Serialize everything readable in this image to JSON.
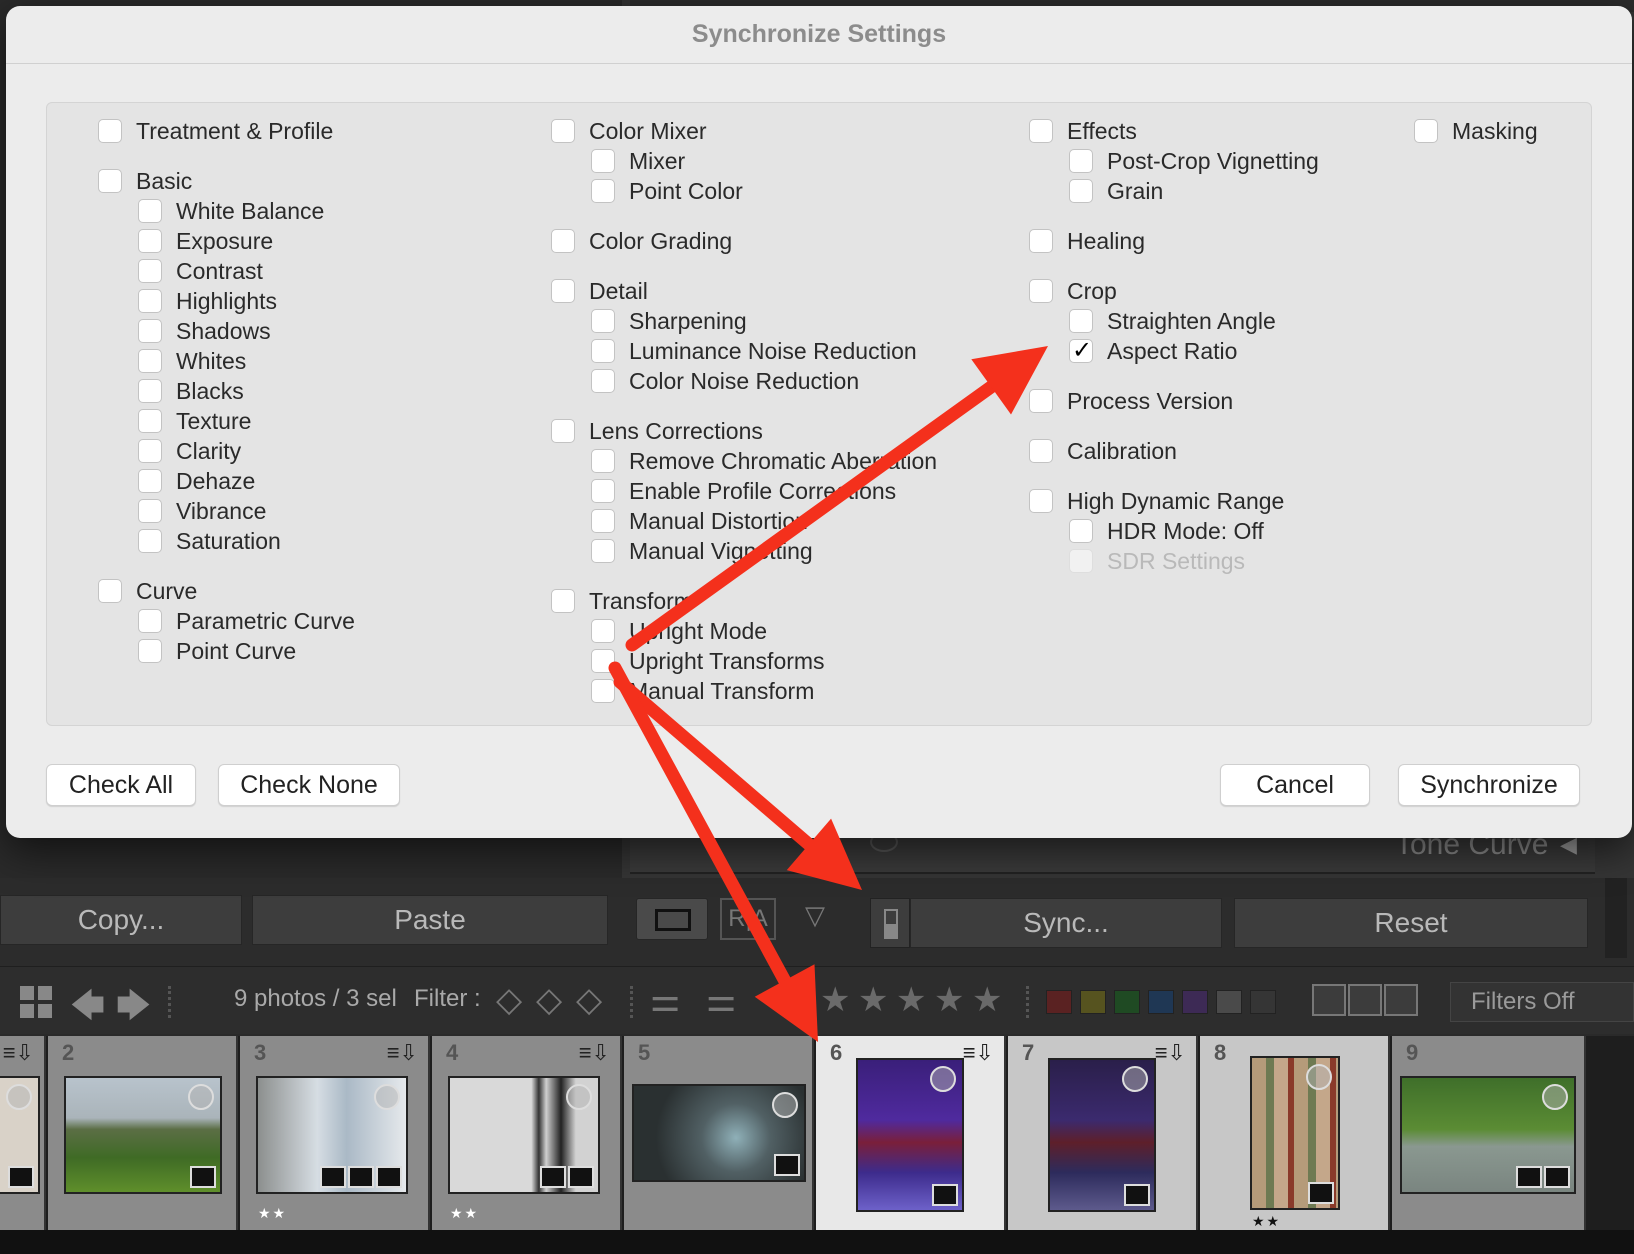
{
  "dialog": {
    "title": "Synchronize Settings",
    "buttons": {
      "check_all": "Check All",
      "check_none": "Check None",
      "cancel": "Cancel",
      "synchronize": "Synchronize"
    }
  },
  "settings": {
    "treatment_profile": {
      "label": "Treatment & Profile",
      "checked": false
    },
    "basic": {
      "label": "Basic",
      "checked": false,
      "children": [
        {
          "label": "White Balance",
          "checked": false
        },
        {
          "label": "Exposure",
          "checked": false
        },
        {
          "label": "Contrast",
          "checked": false
        },
        {
          "label": "Highlights",
          "checked": false
        },
        {
          "label": "Shadows",
          "checked": false
        },
        {
          "label": "Whites",
          "checked": false
        },
        {
          "label": "Blacks",
          "checked": false
        },
        {
          "label": "Texture",
          "checked": false
        },
        {
          "label": "Clarity",
          "checked": false
        },
        {
          "label": "Dehaze",
          "checked": false
        },
        {
          "label": "Vibrance",
          "checked": false
        },
        {
          "label": "Saturation",
          "checked": false
        }
      ]
    },
    "curve": {
      "label": "Curve",
      "checked": false,
      "children": [
        {
          "label": "Parametric Curve",
          "checked": false
        },
        {
          "label": "Point Curve",
          "checked": false
        }
      ]
    },
    "color_mixer": {
      "label": "Color Mixer",
      "checked": false,
      "children": [
        {
          "label": "Mixer",
          "checked": false
        },
        {
          "label": "Point Color",
          "checked": false
        }
      ]
    },
    "color_grading": {
      "label": "Color Grading",
      "checked": false
    },
    "detail": {
      "label": "Detail",
      "checked": false,
      "children": [
        {
          "label": "Sharpening",
          "checked": false
        },
        {
          "label": "Luminance Noise Reduction",
          "checked": false
        },
        {
          "label": "Color Noise Reduction",
          "checked": false
        }
      ]
    },
    "lens_corrections": {
      "label": "Lens Corrections",
      "checked": false,
      "children": [
        {
          "label": "Remove Chromatic Aberration",
          "checked": false
        },
        {
          "label": "Enable Profile Corrections",
          "checked": false
        },
        {
          "label": "Manual Distortion",
          "checked": false
        },
        {
          "label": "Manual Vignetting",
          "checked": false
        }
      ]
    },
    "transform": {
      "label": "Transform",
      "checked": false,
      "children": [
        {
          "label": "Upright Mode",
          "checked": false
        },
        {
          "label": "Upright Transforms",
          "checked": false
        },
        {
          "label": "Manual Transform",
          "checked": false
        }
      ]
    },
    "effects": {
      "label": "Effects",
      "checked": false,
      "children": [
        {
          "label": "Post-Crop Vignetting",
          "checked": false
        },
        {
          "label": "Grain",
          "checked": false
        }
      ]
    },
    "healing": {
      "label": "Healing",
      "checked": false
    },
    "crop": {
      "label": "Crop",
      "checked": false,
      "children": [
        {
          "label": "Straighten Angle",
          "checked": false
        },
        {
          "label": "Aspect Ratio",
          "checked": true
        }
      ]
    },
    "process_version": {
      "label": "Process Version",
      "checked": false
    },
    "calibration": {
      "label": "Calibration",
      "checked": false
    },
    "hdr": {
      "label": "High Dynamic Range",
      "checked": false,
      "children": [
        {
          "label": "HDR Mode: Off",
          "checked": false
        },
        {
          "label": "SDR Settings",
          "checked": false,
          "disabled": true
        }
      ]
    },
    "masking": {
      "label": "Masking",
      "checked": false
    }
  },
  "background": {
    "tone_curve_label": "Tone Curve",
    "copy_button": "Copy...",
    "paste_button": "Paste",
    "view_ra": "R|A",
    "sync_button": "Sync...",
    "reset_button": "Reset",
    "photo_count": "9 photos / 3 sel",
    "filter_label": "Filter :",
    "filters_dropdown": "Filters Off",
    "label_colors": [
      "#5a2222",
      "#56531f",
      "#1f4a23",
      "#1f3754",
      "#3d2a55",
      "#4a4a4a",
      "#353535"
    ]
  },
  "filmstrip": {
    "cells": [
      {
        "num": "2",
        "stars": "",
        "selected": false
      },
      {
        "num": "3",
        "stars": "★★",
        "selected": false
      },
      {
        "num": "4",
        "stars": "★★",
        "selected": false
      },
      {
        "num": "5",
        "stars": "",
        "selected": false
      },
      {
        "num": "6",
        "stars": "",
        "selected": true,
        "active": true
      },
      {
        "num": "7",
        "stars": "",
        "selected": true
      },
      {
        "num": "8",
        "stars": "★★",
        "selected": true
      },
      {
        "num": "9",
        "stars": "",
        "selected": false
      }
    ]
  },
  "annotation": {
    "arrow_color": "#f4301c"
  }
}
